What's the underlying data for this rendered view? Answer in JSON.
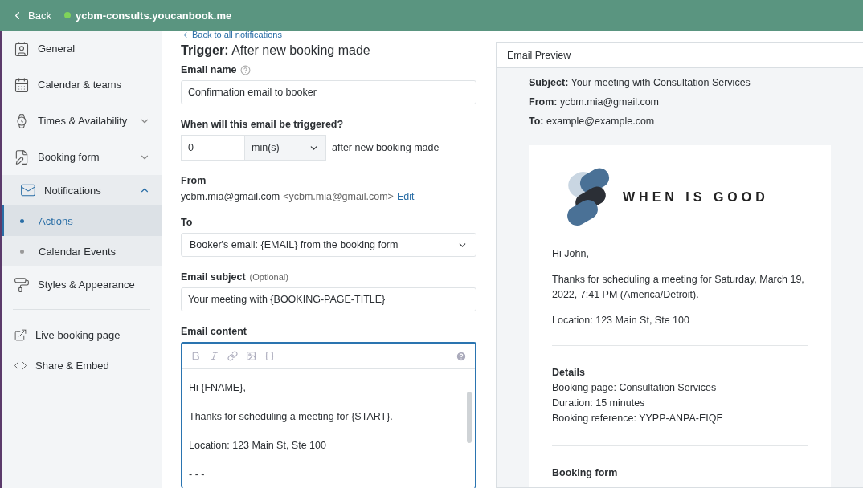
{
  "top_bar": {
    "back": "Back",
    "site": "ycbm-consults.youcanbook.me"
  },
  "sidebar": {
    "items": [
      {
        "label": "General"
      },
      {
        "label": "Calendar & teams"
      },
      {
        "label": "Times & Availability",
        "expanded": false
      },
      {
        "label": "Booking form",
        "expanded": false
      },
      {
        "label": "Notifications",
        "expanded": true,
        "children": [
          {
            "label": "Actions",
            "selected": true
          },
          {
            "label": "Calendar Events",
            "selected": false
          }
        ]
      },
      {
        "label": "Styles & Appearance"
      }
    ],
    "links": [
      {
        "label": "Live booking page"
      },
      {
        "label": "Share & Embed"
      }
    ]
  },
  "form": {
    "back_link": "Back to all notifications",
    "trigger_label": "Trigger:",
    "trigger_value": "After new booking made",
    "email_name": {
      "label": "Email name",
      "value": "Confirmation email to booker"
    },
    "timing": {
      "label": "When will this email be triggered?",
      "amount": "0",
      "unit": "min(s)",
      "suffix": "after new booking made"
    },
    "from": {
      "label": "From",
      "name": "ycbm.mia@gmail.com",
      "address": "<ycbm.mia@gmail.com>",
      "edit": "Edit"
    },
    "to": {
      "label": "To",
      "value": "Booker's email: {EMAIL} from the booking form"
    },
    "subject": {
      "label": "Email subject",
      "hint": "(Optional)",
      "value": "Your meeting with {BOOKING-PAGE-TITLE}"
    },
    "content": {
      "label": "Email content",
      "lines": [
        "Hi {FNAME},",
        "Thanks for scheduling a meeting for {START}.",
        "Location: 123 Main St, Ste 100",
        "- - -"
      ]
    }
  },
  "preview": {
    "title": "Email Preview",
    "headers": [
      {
        "label": "Subject:",
        "value": "Your meeting with Consultation Services"
      },
      {
        "label": "From:",
        "value": "ycbm.mia@gmail.com"
      },
      {
        "label": "To:",
        "value": "example@example.com"
      }
    ],
    "logo_text": "WHEN IS GOOD",
    "paragraphs": [
      "Hi John,",
      "Thanks for scheduling a meeting for Saturday, March 19, 2022, 7:41 PM (America/Detroit).",
      "Location: 123 Main St, Ste 100"
    ],
    "details": {
      "title": "Details",
      "lines": [
        "Booking page: Consultation Services",
        "Duration: 15 minutes",
        "Booking reference: YYPP-ANPA-EIQE"
      ]
    },
    "next_section": "Booking form"
  }
}
